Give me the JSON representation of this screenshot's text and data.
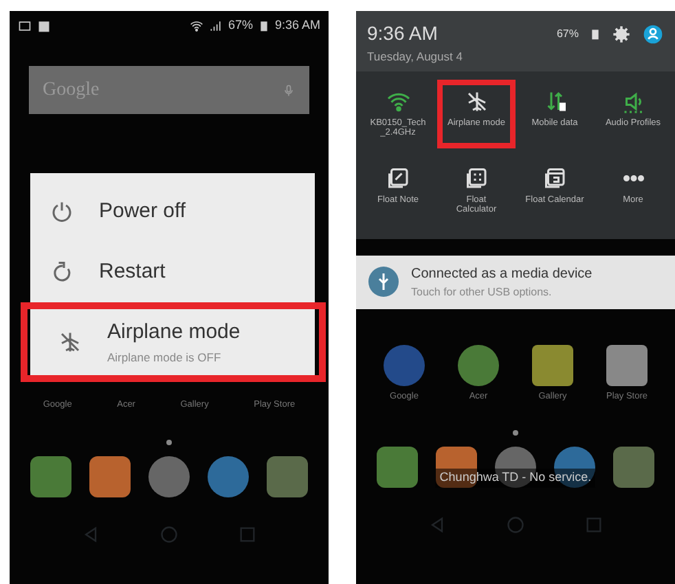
{
  "left_screen": {
    "status_bar": {
      "battery": "67%",
      "time": "9:36 AM"
    },
    "search": {
      "placeholder": "Google"
    },
    "power_menu": [
      {
        "kind": "power",
        "label": "Power off",
        "highlighted": false
      },
      {
        "kind": "restart",
        "label": "Restart",
        "highlighted": false
      },
      {
        "kind": "airplane",
        "label": "Airplane mode",
        "subtitle": "Airplane mode is OFF",
        "highlighted": true
      }
    ],
    "apps": [
      "Google",
      "Acer",
      "Gallery",
      "Play Store"
    ]
  },
  "right_screen": {
    "header": {
      "time": "9:36 AM",
      "date": "Tuesday, August 4",
      "battery": "67%"
    },
    "quick_tiles": [
      {
        "kind": "wifi",
        "label": "KB0150_Tech_2.4GHz",
        "on": true,
        "highlighted": false
      },
      {
        "kind": "airplane",
        "label": "Airplane mode",
        "on": false,
        "highlighted": true
      },
      {
        "kind": "mobile-data",
        "label": "Mobile data",
        "on": true,
        "highlighted": false
      },
      {
        "kind": "audio",
        "label": "Audio Profiles",
        "on": true,
        "highlighted": false
      },
      {
        "kind": "note",
        "label": "Float Note",
        "on": false,
        "highlighted": false
      },
      {
        "kind": "calculator",
        "label": "Float Calculator",
        "on": false,
        "highlighted": false
      },
      {
        "kind": "calendar",
        "label": "Float Calendar",
        "on": false,
        "highlighted": false
      },
      {
        "kind": "more",
        "label": "More",
        "on": false,
        "highlighted": false
      }
    ],
    "notification": {
      "title": "Connected as a media device",
      "text": "Touch for other USB options."
    },
    "apps": [
      "Google",
      "Acer",
      "Gallery",
      "Play Store"
    ],
    "carrier_text": "Chunghwa TD - No service."
  }
}
